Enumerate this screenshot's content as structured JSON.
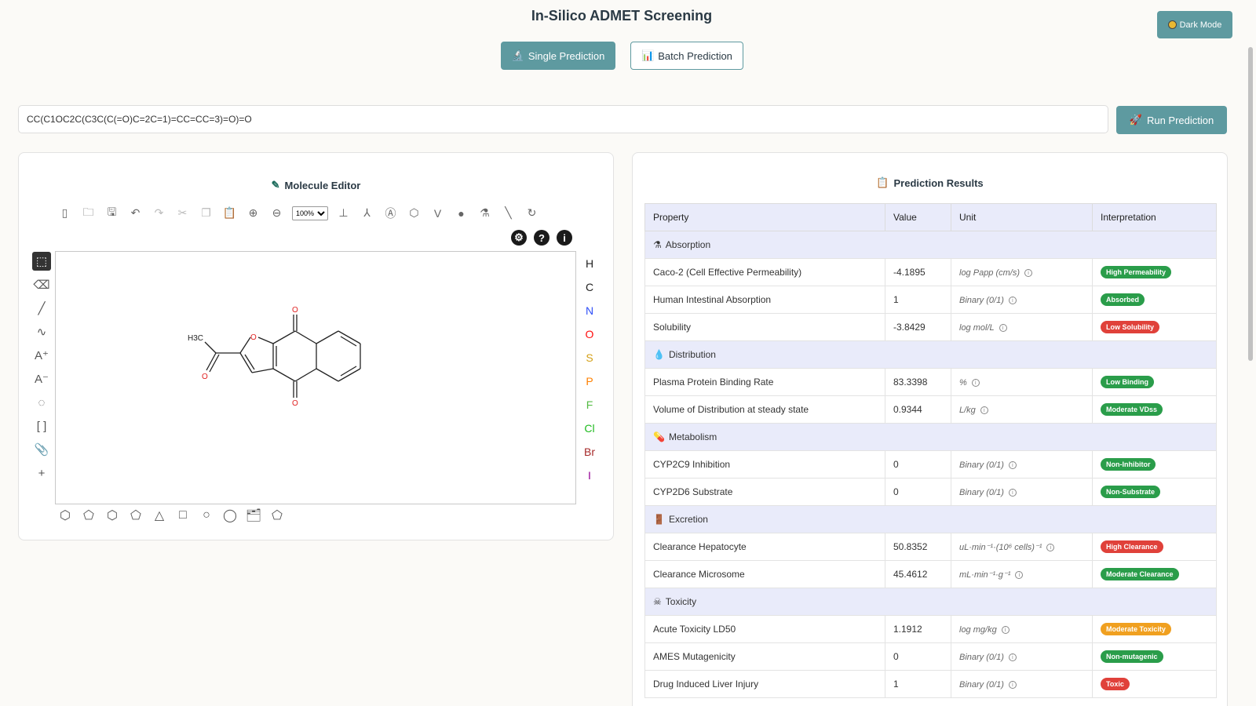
{
  "app": {
    "title": "In-Silico ADMET Screening",
    "dark_mode_label": "Dark Mode"
  },
  "modes": {
    "single_label": "Single Prediction",
    "batch_label": "Batch Prediction",
    "active": "single"
  },
  "smiles": {
    "value": "CC(C1OC2C(C3C(C(=O)C=2C=1)=CC=CC=3)=O)=O",
    "run_label": "Run Prediction"
  },
  "editor": {
    "title": "Molecule Editor",
    "zoom": "100%",
    "atoms": [
      {
        "symbol": "H",
        "color": "#222222"
      },
      {
        "symbol": "C",
        "color": "#222222"
      },
      {
        "symbol": "N",
        "color": "#3050f8"
      },
      {
        "symbol": "O",
        "color": "#ff0d0d"
      },
      {
        "symbol": "S",
        "color": "#d4a017"
      },
      {
        "symbol": "P",
        "color": "#ff8000"
      },
      {
        "symbol": "F",
        "color": "#55bb44"
      },
      {
        "symbol": "Cl",
        "color": "#1fbb1f"
      },
      {
        "symbol": "Br",
        "color": "#a62929"
      },
      {
        "symbol": "I",
        "color": "#940094"
      }
    ],
    "molecule_label": "H3C"
  },
  "results": {
    "title": "Prediction Results",
    "columns": [
      "Property",
      "Value",
      "Unit",
      "Interpretation"
    ],
    "categories": [
      {
        "name": "Absorption",
        "icon": "flask-icon",
        "rows": [
          {
            "property": "Caco-2 (Cell Effective Permeability)",
            "value": "-4.1895",
            "unit": "log Papp (cm/s)",
            "interp": "High Permeability",
            "color": "green"
          },
          {
            "property": "Human Intestinal Absorption",
            "value": "1",
            "unit": "Binary (0/1)",
            "interp": "Absorbed",
            "color": "green"
          },
          {
            "property": "Solubility",
            "value": "-3.8429",
            "unit": "log mol/L",
            "interp": "Low Solubility",
            "color": "red"
          }
        ]
      },
      {
        "name": "Distribution",
        "icon": "drop-icon",
        "rows": [
          {
            "property": "Plasma Protein Binding Rate",
            "value": "83.3398",
            "unit": "%",
            "interp": "Low Binding",
            "color": "green"
          },
          {
            "property": "Volume of Distribution at steady state",
            "value": "0.9344",
            "unit": "L/kg",
            "interp": "Moderate VDss",
            "color": "green"
          }
        ]
      },
      {
        "name": "Metabolism",
        "icon": "pill-icon",
        "rows": [
          {
            "property": "CYP2C9 Inhibition",
            "value": "0",
            "unit": "Binary (0/1)",
            "interp": "Non-Inhibitor",
            "color": "green"
          },
          {
            "property": "CYP2D6 Substrate",
            "value": "0",
            "unit": "Binary (0/1)",
            "interp": "Non-Substrate",
            "color": "green"
          }
        ]
      },
      {
        "name": "Excretion",
        "icon": "door-icon",
        "rows": [
          {
            "property": "Clearance Hepatocyte",
            "value": "50.8352",
            "unit": "uL·min⁻¹·(10⁶ cells)⁻¹",
            "interp": "High Clearance",
            "color": "red"
          },
          {
            "property": "Clearance Microsome",
            "value": "45.4612",
            "unit": "mL·min⁻¹·g⁻¹",
            "interp": "Moderate Clearance",
            "color": "green"
          }
        ]
      },
      {
        "name": "Toxicity",
        "icon": "skull-icon",
        "rows": [
          {
            "property": "Acute Toxicity LD50",
            "value": "1.1912",
            "unit": "log mg/kg",
            "interp": "Moderate Toxicity",
            "color": "orange"
          },
          {
            "property": "AMES Mutagenicity",
            "value": "0",
            "unit": "Binary (0/1)",
            "interp": "Non-mutagenic",
            "color": "green"
          },
          {
            "property": "Drug Induced Liver Injury",
            "value": "1",
            "unit": "Binary (0/1)",
            "interp": "Toxic",
            "color": "red"
          }
        ]
      }
    ]
  }
}
